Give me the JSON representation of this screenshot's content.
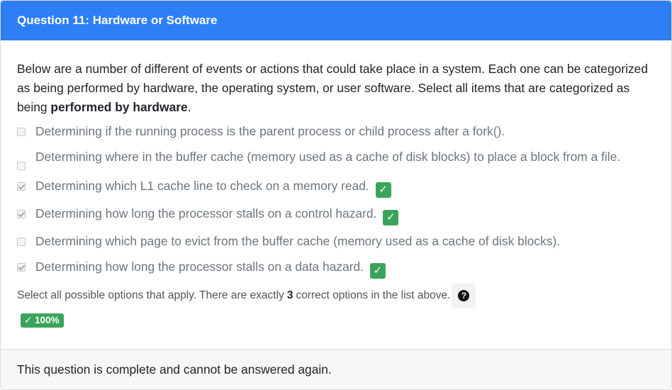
{
  "header": {
    "title": "Question 11: Hardware or Software"
  },
  "prompt": {
    "text_before": "Below are a number of different of events or actions that could take place in a system. Each one can be categorized as being performed by hardware, the operating system, or user software. Select all items that are categorized as being ",
    "bold": "performed by hardware",
    "text_after": "."
  },
  "options": [
    {
      "label": "Determining if the running process is the parent process or child process after a fork().",
      "checked": false,
      "correct": false
    },
    {
      "label": "Determining where in the buffer cache (memory used as a cache of disk blocks) to place a block from a file.",
      "checked": false,
      "correct": false
    },
    {
      "label": "Determining which L1 cache line to check on a memory read.",
      "checked": true,
      "correct": true
    },
    {
      "label": "Determining how long the processor stalls on a control hazard.",
      "checked": true,
      "correct": true
    },
    {
      "label": "Determining which page to evict from the buffer cache (memory used as a cache of disk blocks).",
      "checked": false,
      "correct": false
    },
    {
      "label": "Determining how long the processor stalls on a data hazard.",
      "checked": true,
      "correct": true
    }
  ],
  "hint": {
    "before": "Select all possible options that apply. There are exactly",
    "count": "3",
    "after": "correct options in the list above."
  },
  "help_icon": "question-circle-icon",
  "score": {
    "check": "✓",
    "value": "100%"
  },
  "footer": {
    "text": "This question is complete and cannot be answered again."
  },
  "colors": {
    "header": "#2f7ef5",
    "success": "#3aa55a",
    "footer_bg": "#f7f7f7"
  }
}
